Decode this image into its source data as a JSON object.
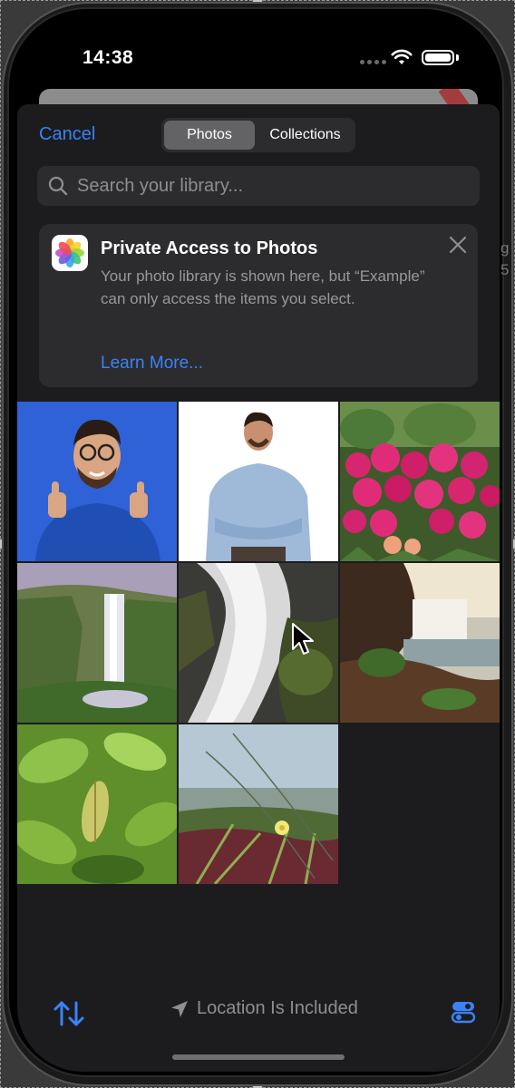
{
  "status_bar": {
    "time": "14:38"
  },
  "header": {
    "cancel_label": "Cancel",
    "segments": {
      "photos": "Photos",
      "collections": "Collections"
    },
    "selected_segment": "Photos"
  },
  "search": {
    "placeholder": "Search your library..."
  },
  "privacy_card": {
    "title": "Private Access to Photos",
    "body": "Your photo library is shown here, but “Example” can only access the items you select.",
    "link": "Learn More..."
  },
  "photos": [
    {
      "name": "man-thumbs-up",
      "icon": "photo-thumbnail"
    },
    {
      "name": "man-arms-crossed",
      "icon": "photo-thumbnail"
    },
    {
      "name": "pink-flowers",
      "icon": "photo-thumbnail"
    },
    {
      "name": "waterfall-cliff",
      "icon": "photo-thumbnail"
    },
    {
      "name": "waterfall-closeup",
      "icon": "photo-thumbnail"
    },
    {
      "name": "waterfall-coast",
      "icon": "photo-thumbnail"
    },
    {
      "name": "green-leaves",
      "icon": "photo-thumbnail"
    },
    {
      "name": "yellow-flower-grass",
      "icon": "photo-thumbnail"
    }
  ],
  "toolbar": {
    "location_label": "Location Is Included",
    "sort_icon": "sort-arrows-icon",
    "options_icon": "toggles-icon"
  },
  "colors": {
    "accent": "#3a82f7",
    "sheet_background": "#1c1c1e",
    "secondary_background": "#2c2c2e",
    "secondary_text": "#8e8e93"
  }
}
